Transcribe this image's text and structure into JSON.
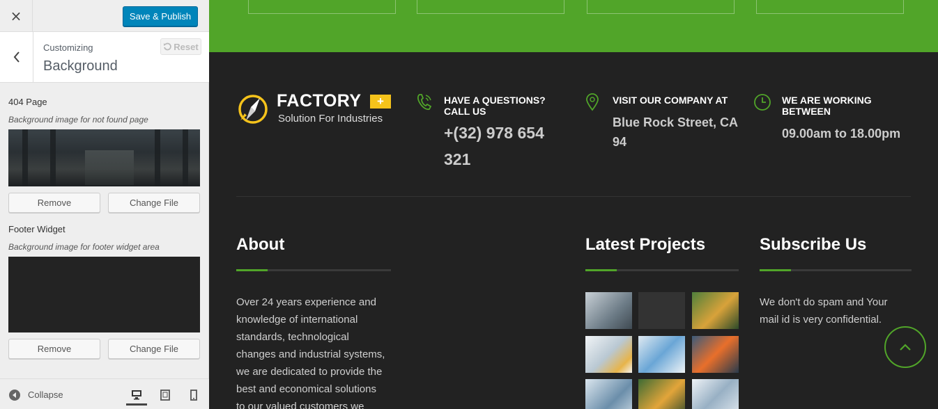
{
  "customizer": {
    "close_label": "×",
    "publish_label": "Save & Publish",
    "breadcrumb": "Customizing",
    "section_title": "Background",
    "reset_label": "Reset",
    "controls": [
      {
        "label": "404 Page",
        "description": "Background image for not found page",
        "remove_label": "Remove",
        "change_label": "Change File"
      },
      {
        "label": "Footer Widget",
        "description": "Background image for footer widget area",
        "remove_label": "Remove",
        "change_label": "Change File"
      }
    ],
    "collapse_label": "Collapse",
    "devices": [
      "desktop",
      "tablet",
      "mobile"
    ],
    "active_device": "desktop"
  },
  "site": {
    "logo": {
      "name": "FACTORY",
      "plus": "+",
      "tagline": "Solution For Industries"
    },
    "info": [
      {
        "icon": "phone-icon",
        "heading": "HAVE A QUESTIONS? CALL US",
        "heading_lines": [
          "HAVE A QUESTIONS?",
          "CALL US"
        ],
        "value_lines": [
          "+(32) 978 654",
          "321"
        ]
      },
      {
        "icon": "map-pin-icon",
        "heading": "VISIT OUR COMPANY AT",
        "heading_lines": [
          "VISIT OUR COMPANY AT"
        ],
        "value_lines": [
          "Blue Rock Street, CA",
          "94"
        ]
      },
      {
        "icon": "clock-icon",
        "heading": "WE ARE WORKING BETWEEN",
        "heading_lines": [
          "WE ARE WORKING",
          "BETWEEN"
        ],
        "value_lines": [
          "09.00am to 18.00pm"
        ]
      }
    ],
    "about": {
      "title": "About",
      "text_lines": [
        "Over 24 years experience and",
        "knowledge of international",
        "standards, technological",
        "changes and industrial systems,",
        "we are dedicated to provide the",
        "best and economical solutions",
        "to our valued customers we"
      ]
    },
    "projects": {
      "title": "Latest Projects",
      "count": 9
    },
    "subscribe": {
      "title": "Subscribe Us",
      "text_lines": [
        "We don't do spam and Your",
        "mail id is very confidential."
      ]
    },
    "colors": {
      "accent": "#51a529",
      "footer_bg": "#222222",
      "logo_plus": "#f5c31b",
      "publish": "#0085ba"
    }
  }
}
